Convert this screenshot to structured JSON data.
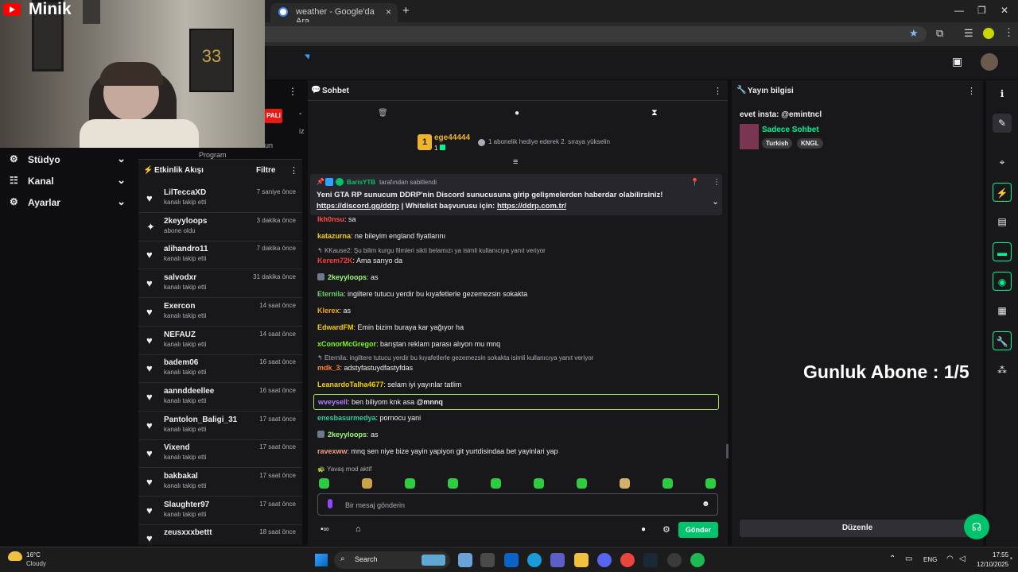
{
  "browser": {
    "tab_title": "weather - Google'da Ara",
    "new_tab": "+",
    "tab_close": "×",
    "minimize": "—",
    "restore": "❐",
    "close": "✕"
  },
  "webcam": {
    "brand": "Minik",
    "frame_text": "33",
    "overlay_badge": "PALI",
    "overlay_partial_1": "un",
    "overlay_partial_2": "Program",
    "overlay_partial_3": "iz"
  },
  "nav": {
    "items": [
      {
        "label": "Stüdyo",
        "icon": "⚙"
      },
      {
        "label": "Kanal",
        "icon": "☷"
      },
      {
        "label": "Ayarlar",
        "icon": "⚙"
      }
    ]
  },
  "feed": {
    "title": "Etkinlik Akışı",
    "filter": "Filtre",
    "items": [
      {
        "name": "LilTeccaXD",
        "sub": "kanalı takip etti",
        "time": "7 saniye önce",
        "icon": "heart"
      },
      {
        "name": "2keyyloops",
        "sub": "abone oldu",
        "time": "3 dakika önce",
        "icon": "star"
      },
      {
        "name": "alihandro11",
        "sub": "kanalı takip etti",
        "time": "7 dakika önce",
        "icon": "heart"
      },
      {
        "name": "salvodxr",
        "sub": "kanalı takip etti",
        "time": "31 dakika önce",
        "icon": "heart"
      },
      {
        "name": "Exercon",
        "sub": "kanalı takip etti",
        "time": "14 saat önce",
        "icon": "heart"
      },
      {
        "name": "NEFAUZ",
        "sub": "kanalı takip etti",
        "time": "14 saat önce",
        "icon": "heart"
      },
      {
        "name": "badem06",
        "sub": "kanalı takip etti",
        "time": "16 saat önce",
        "icon": "heart"
      },
      {
        "name": "aannddeellee",
        "sub": "kanalı takip etti",
        "time": "16 saat önce",
        "icon": "heart"
      },
      {
        "name": "Pantolon_Baligi_31",
        "sub": "kanalı takip etti",
        "time": "17 saat önce",
        "icon": "heart"
      },
      {
        "name": "Vixend",
        "sub": "kanalı takip etti",
        "time": "17 saat önce",
        "icon": "heart"
      },
      {
        "name": "bakbakal",
        "sub": "kanalı takip etti",
        "time": "17 saat önce",
        "icon": "heart"
      },
      {
        "name": "Slaughter97",
        "sub": "kanalı takip etti",
        "time": "17 saat önce",
        "icon": "heart"
      },
      {
        "name": "zeusxxxbettt",
        "sub": "",
        "time": "18 saat önce",
        "icon": "heart"
      }
    ]
  },
  "chat": {
    "title": "Sohbet",
    "leader_name": "ege44444",
    "leader_count": "1",
    "leader_rank": "1",
    "leader_text": "1 abonelik hediye ederek 2. sıraya yükselin",
    "pinned_by_user": "BarisYTB",
    "pinned_by_suffix": "tarafından sabitlendi",
    "pinned_line1": "Yeni GTA RP sunucum DDRP'nin Discord sunucusuna girip gelişmelerden haberdar olabilirsiniz!",
    "pinned_link1": "https://discord.gg/ddrp",
    "pinned_mid": " | Whitelist başvurusu için: ",
    "pinned_link2": "https://ddrp.com.tr/",
    "messages": [
      {
        "user": "Ikh0nsu",
        "color": "#ff4a4a",
        "text": ": sa"
      },
      {
        "user": "katazurna",
        "color": "#f5d000",
        "text": ": ne bileyim england fiyatlarını"
      },
      {
        "reply": "KKause2: Şu bilim kurgu filmleri sikti belamızı ya isimli kullanıcıya yanıt veriyor"
      },
      {
        "user": "Kerem72K",
        "color": "#ff3b3b",
        "text": ": Ama sarıyo da"
      },
      {
        "user": "2keyyloops",
        "color": "#9dfc7a",
        "text": ": as"
      },
      {
        "user": "Eternila",
        "color": "#6bd26b",
        "text": ": ingiltere tutucu yerdir bu kıyafetlerle gezemezsin sokakta"
      },
      {
        "user": "Klerex",
        "color": "#f5a623",
        "text": ": as"
      },
      {
        "user": "EdwardFM",
        "color": "#f5d000",
        "text": ": Emin bizim buraya kar yağıyor ha"
      },
      {
        "user": "xConorMcGregor",
        "color": "#7cfc00",
        "text": ": barıştan reklam parası alıyon mu mnq"
      },
      {
        "reply": "Eternila: ingiltere tutucu yerdir bu kıyafetlerle gezemezsin sokakta isimli kullanıcıya yanıt veriyor"
      },
      {
        "user": "mdk_3",
        "color": "#ff7f27",
        "text": ": adstyfastuydfastyfdas"
      },
      {
        "user": "LeanardoTalha4677",
        "color": "#f5d000",
        "text": ": selam iyi yayınlar tatlim"
      },
      {
        "user": "wveysell",
        "color": "#b57cff",
        "text": ": ben biliyom knk asa ",
        "mention": "@mnnq"
      },
      {
        "user": "enesbasurmedya",
        "color": "#2ecc9a",
        "text": ": pornocu yani"
      },
      {
        "user": "2keyyloops",
        "color": "#9dfc7a",
        "text": ": as"
      },
      {
        "user": "ravexww",
        "color": "#f0a080",
        "text": ": mnq sen niye bize yayin yapiyon git yurtdisindaa bet yayinlari yap"
      }
    ],
    "slow_mode": "Yavaş mod aktif",
    "input_placeholder": "Bir mesaj gönderin",
    "send_label": "Gönder"
  },
  "info": {
    "title": "Yayın bilgisi",
    "stream_title": "evet insta: @emintncl",
    "category": "Sadece Sohbet",
    "tags": [
      "Turkish",
      "KNGL"
    ],
    "overlay_text": "Gunluk Abone : 1/5",
    "edit_label": "Düzenle"
  },
  "taskbar": {
    "temp": "16°C",
    "weather": "Cloudy",
    "search": "Search",
    "lang": "ENG",
    "time": "17:55",
    "date": "12/10/2025"
  },
  "colors": {
    "accent": "#00f593",
    "bg": "#0e0e10",
    "panel": "#18181b",
    "twitch_purple": "#9147ff"
  }
}
